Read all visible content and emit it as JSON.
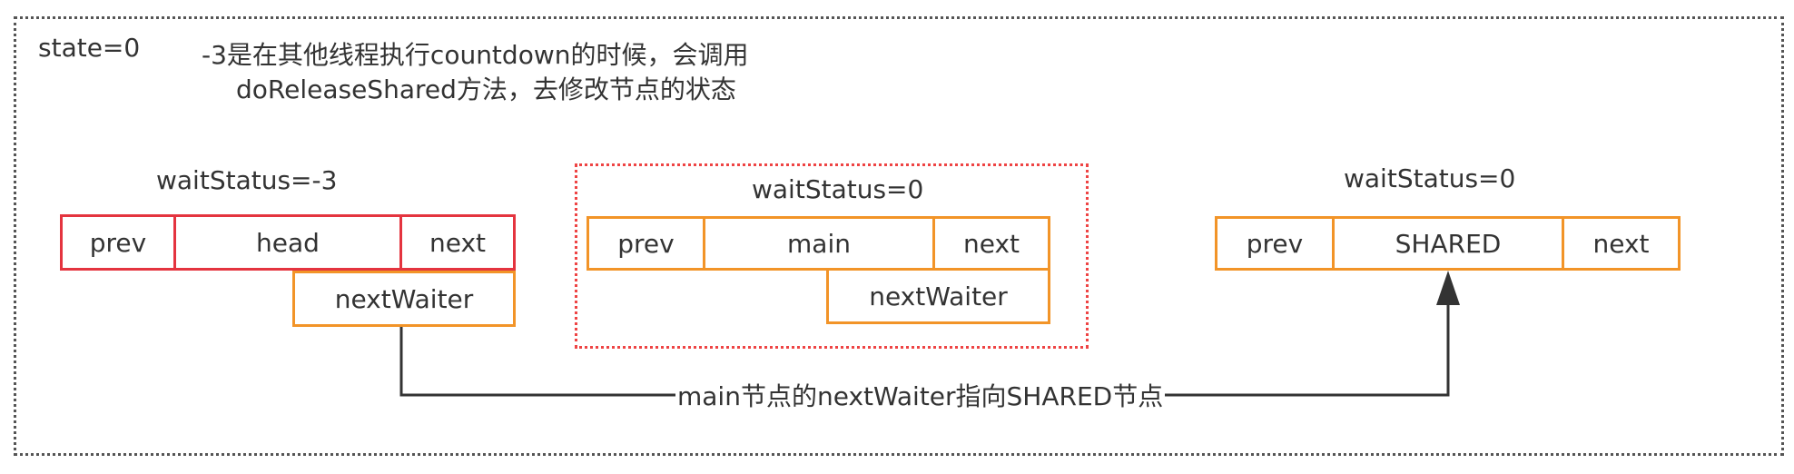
{
  "state_label": "state=0",
  "note": {
    "line1": "-3是在其他线程执行countdown的时候，会调用",
    "line2": "doReleaseShared方法，去修改节点的状态"
  },
  "nodes": [
    {
      "wait_status": "waitStatus=-3",
      "prev": "prev",
      "center": "head",
      "next": "next",
      "next_waiter": "nextWaiter",
      "border_color": "#e4343f"
    },
    {
      "wait_status": "waitStatus=0",
      "prev": "prev",
      "center": "main",
      "next": "next",
      "next_waiter": "nextWaiter",
      "border_color": "#f29428"
    },
    {
      "wait_status": "waitStatus=0",
      "prev": "prev",
      "center": "SHARED",
      "next": "next",
      "border_color": "#f29428"
    }
  ],
  "edge_label": "main节点的nextWaiter指向SHARED节点",
  "colors": {
    "orange": "#f29428",
    "red": "#e4343f",
    "highlight": "#ee4444",
    "frame": "#555555"
  }
}
